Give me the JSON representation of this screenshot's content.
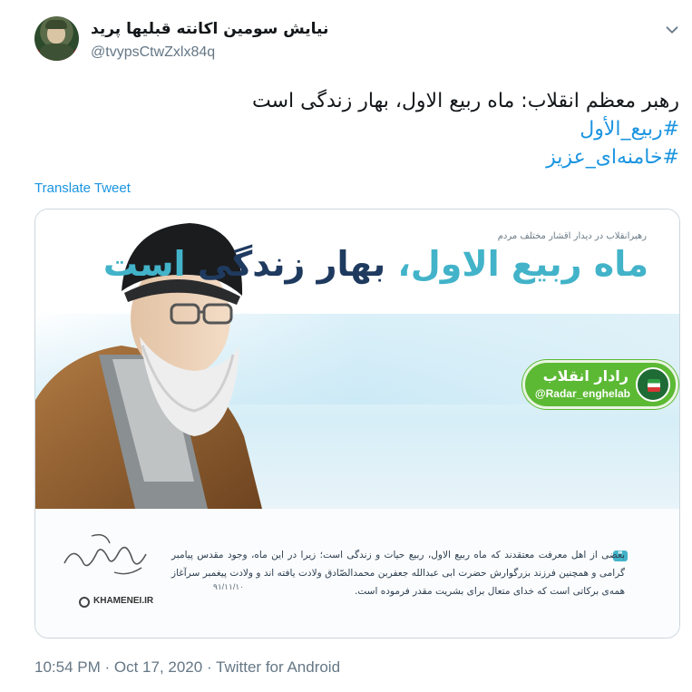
{
  "author": {
    "name": "نیایش سومین اکانته قبلیها پرید",
    "handle": "@tvypsCtwZxlx84q"
  },
  "tweet": {
    "lines": [
      "رهبر معظم انقلاب: ماه ربیع الاول، بهار زندگی است"
    ],
    "hashtags": [
      "#ربیع_الأول",
      "#خامنه‌ای_عزیز"
    ],
    "translate_label": "Translate Tweet"
  },
  "image": {
    "subtitle": "رهبرانقلاب در دیدار اقشار مختلف مردم",
    "title_part1": "ماه ربیع الاول،",
    "title_part2": " بهار زندگی",
    "title_part3": " است",
    "badge_name": "رادار انقلاب",
    "badge_handle": "@Radar_enghelab",
    "quote": "بعضی از اهل معرفت معتقدند که ماه ربیع الاول، ربیع حیات و زندگی است؛ زیرا در این ماه، وجود مقدس پیامبر گرامی و همچنین فرزند بزرگوارش حضرت ابی عبدالله جعفربن محمدالصّادق ولادت یافته اند و ولادت پیغمبر سرآغاز همه‌ی برکاتی است که خدای متعال برای بشریت مقدر فرموده است.",
    "quote_date": "۹۱/۱۱/۱۰",
    "site_label": "KHAMENEI.IR",
    "colors": {
      "accent_teal": "#42b3c9",
      "accent_navy": "#1f3a5f",
      "badge_green": "#5cb934"
    }
  },
  "footer": {
    "time": "10:54 PM",
    "separator": " · ",
    "date": "Oct 17, 2020",
    "source": "Twitter for Android"
  },
  "icons": {
    "caret": "chevron-down-icon"
  }
}
